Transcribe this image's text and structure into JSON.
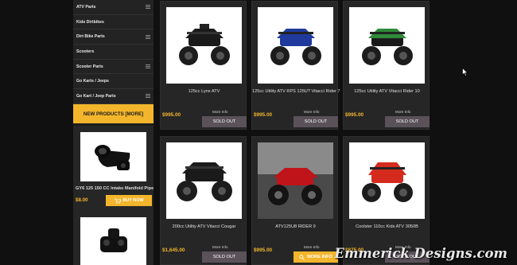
{
  "sidebar": {
    "items": [
      {
        "label": "ATV Parts",
        "has_menu": true
      },
      {
        "label": "Kids Dirtbikes",
        "has_menu": false
      },
      {
        "label": "Dirt Bike Parts",
        "has_menu": true
      },
      {
        "label": "Scooters",
        "has_menu": false
      },
      {
        "label": "Scooter Parts",
        "has_menu": true
      },
      {
        "label": "Go Karts / Jeeps",
        "has_menu": false
      },
      {
        "label": "Go Kart / Jeep Parts",
        "has_menu": true
      }
    ],
    "new_products": "NEW PRODUCTS  [MORE]",
    "featured": {
      "name": "GY6 125 150 CC Intake Manifold Pipe",
      "price": "$8.00",
      "buy_label": "BUY NOW"
    }
  },
  "products": [
    {
      "title": "125cc Lynx ATV",
      "price": "$995.00",
      "more_info": "More Info",
      "button": "SOLD OUT",
      "accent": "#1a1a1a"
    },
    {
      "title": "125cc Utility ATV RPS 125U? Vitacci Rider 7",
      "price": "$995.00",
      "more_info": "More Info",
      "button": "SOLD OUT",
      "accent": "#1f3a9c"
    },
    {
      "title": "125cc Utility ATV Vitacci Rider 10",
      "price": "$995.00",
      "more_info": "More Info",
      "button": "SOLD OUT",
      "accent": "#2f8a3a"
    },
    {
      "title": "200cc Utility ATV Vitacci Cougar",
      "price": "$1,645.00",
      "more_info": "More Info",
      "button": "SOLD OUT",
      "accent": "#1a1a1a"
    },
    {
      "title": "ATV125U8 RIDER 9",
      "price": "$995.00",
      "more_info": "More Info",
      "button": "MORE INFO",
      "accent": "#c0141b"
    },
    {
      "title": "Coolster 110cc Kids ATV 3050B",
      "price": "$875.00",
      "more_info": "More Info",
      "button": "SOLD OUT",
      "accent": "#d52b1e"
    }
  ],
  "colors": {
    "accent": "#f3b52b",
    "sold_out": "#5a5159",
    "page_bg": "#101010"
  },
  "watermark": "Emmerick Designs.com"
}
